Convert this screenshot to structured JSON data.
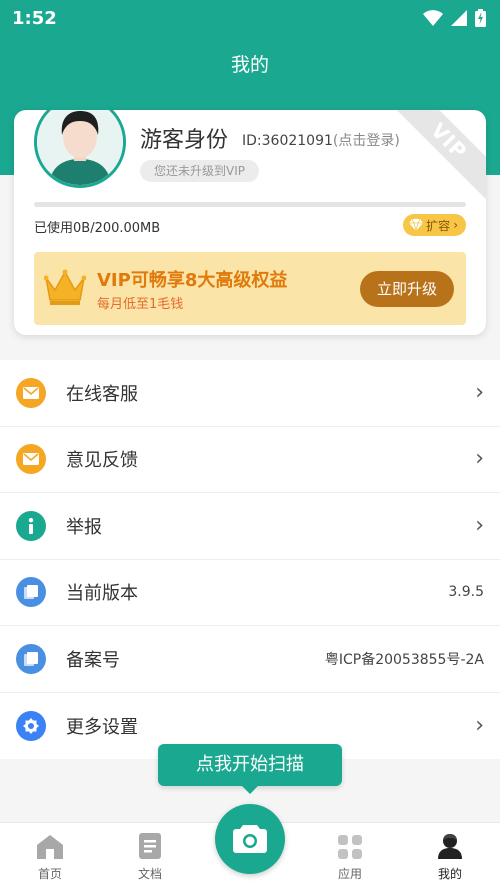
{
  "status_bar": {
    "time": "1:52"
  },
  "header": {
    "title": "我的"
  },
  "profile": {
    "username": "游客身份",
    "id_text": "ID:36021091",
    "login_text": "(点击登录)",
    "vip_status": "您还未升级到VIP",
    "ribbon": "VIP",
    "storage_text": "已使用0B/200.00MB",
    "storage_used_fraction": 0,
    "expand_label": "扩容"
  },
  "vip_banner": {
    "title": "VIP可畅享8大高级权益",
    "subtitle": "每月低至1毛钱",
    "button_label": "立即升级"
  },
  "menu": [
    {
      "label": "在线客服",
      "icon": "mail-icon",
      "color": "#f5a623",
      "value": "",
      "chevron": true
    },
    {
      "label": "意见反馈",
      "icon": "mail-icon",
      "color": "#f5a623",
      "value": "",
      "chevron": true
    },
    {
      "label": "举报",
      "icon": "info-icon",
      "color": "#1ba891",
      "value": "",
      "chevron": true
    },
    {
      "label": "当前版本",
      "icon": "copy-icon",
      "color": "#4a90e2",
      "value": "3.9.5",
      "chevron": false
    },
    {
      "label": "备案号",
      "icon": "copy-icon",
      "color": "#4a90e2",
      "value": "粤ICP备20053855号-2A",
      "chevron": false
    },
    {
      "label": "更多设置",
      "icon": "gear-icon",
      "color": "#3b82f6",
      "value": "",
      "chevron": true
    }
  ],
  "scan_tooltip": "点我开始扫描",
  "bottom_nav": [
    {
      "label": "首页",
      "icon": "home-icon"
    },
    {
      "label": "文档",
      "icon": "document-icon"
    },
    {
      "label": "应用",
      "icon": "apps-icon"
    },
    {
      "label": "我的",
      "icon": "profile-icon"
    }
  ],
  "colors": {
    "primary": "#1ba891",
    "vip_gold": "#f7c646",
    "upgrade_brown": "#b8731a",
    "vip_orange": "#e07a0c"
  }
}
